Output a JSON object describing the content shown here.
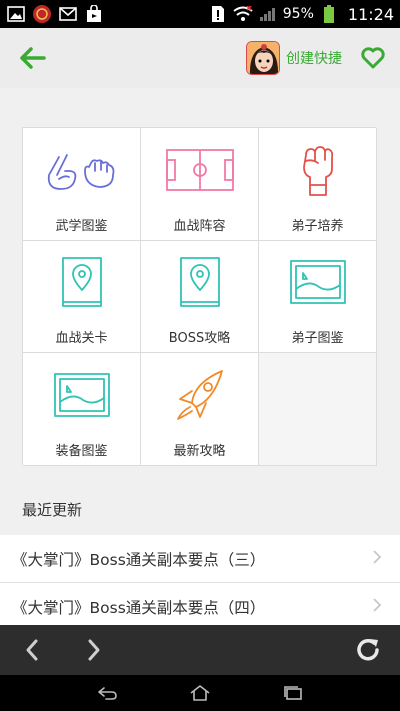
{
  "status_bar": {
    "battery": "95%",
    "time": "11:24"
  },
  "header": {
    "shortcut_label": "创建快捷"
  },
  "grid": {
    "items": [
      {
        "label": "武学图鉴"
      },
      {
        "label": "血战阵容"
      },
      {
        "label": "弟子培养"
      },
      {
        "label": "血战关卡"
      },
      {
        "label": "BOSS攻略"
      },
      {
        "label": "弟子图鉴"
      },
      {
        "label": "装备图鉴"
      },
      {
        "label": "最新攻略"
      }
    ]
  },
  "recent": {
    "title": "最近更新",
    "items": [
      {
        "title": "《大掌门》Boss通关副本要点（三）"
      },
      {
        "title": "《大掌门》Boss通关副本要点（四）"
      }
    ]
  },
  "colors": {
    "accent_green": "#3aaa35",
    "icon_purple": "#6a6fd6",
    "icon_pink": "#f07aa8",
    "icon_red": "#e2524b",
    "icon_teal": "#2fc3b3",
    "icon_orange": "#f08a2a"
  }
}
